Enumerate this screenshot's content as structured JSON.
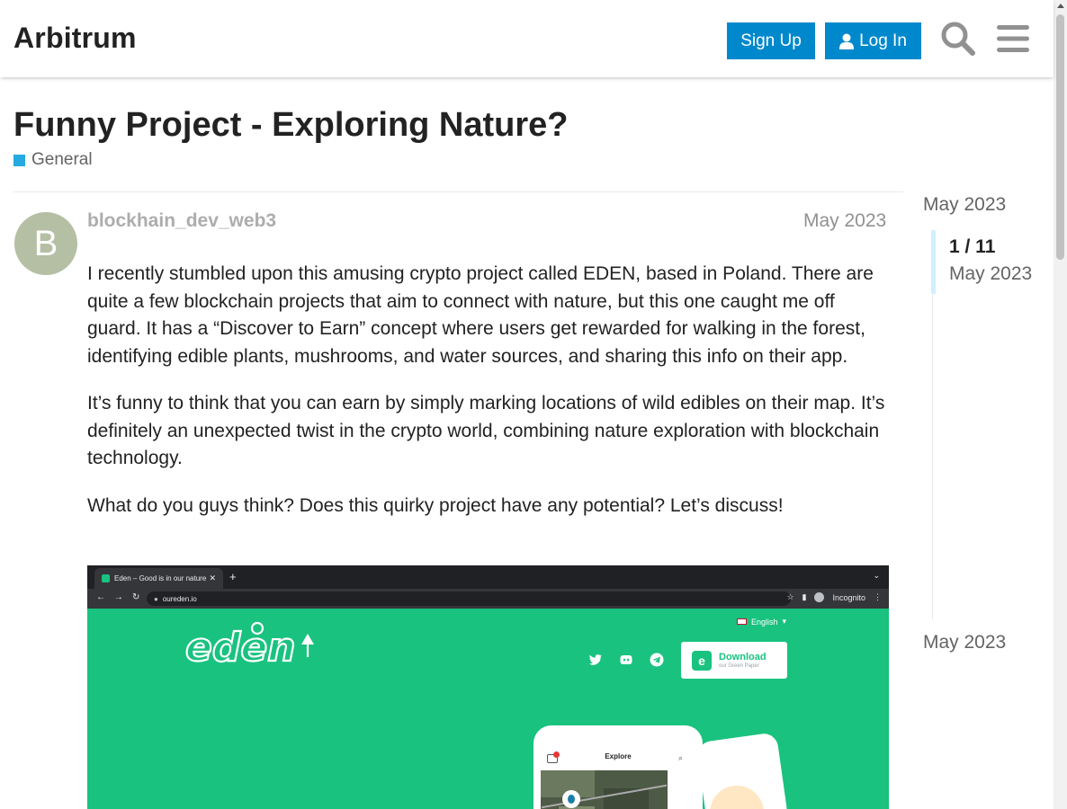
{
  "header": {
    "site_title": "Arbitrum",
    "signup_label": "Sign Up",
    "login_label": "Log In",
    "accent_color": "#0088cc"
  },
  "topic": {
    "title": "Funny Project - Exploring Nature?",
    "category": "General",
    "category_color": "#25aae2"
  },
  "post": {
    "avatar_letter": "B",
    "avatar_color": "#b4bfa4",
    "username": "blockhain_dev_web3",
    "date": "May 2023",
    "paragraphs": [
      "I recently stumbled upon this amusing crypto project called EDEN, based in Poland. There are quite a few blockchain projects that aim to connect with nature, but this one caught me off guard. It has a “Discover to Earn” concept where users get rewarded for walking in the forest, identifying edible plants, mushrooms, and water sources, and sharing this info on their app.",
      "It’s funny to think that you can earn by simply marking locations of wild edibles on their map. It’s definitely an unexpected twist in the crypto world, combining nature exploration with blockchain technology.",
      "What do you guys think? Does this quirky project have any potential? Let’s discuss!"
    ]
  },
  "embed": {
    "tab_title": "Eden – Good is in our nature",
    "url": "oureden.io",
    "incognito_label": "Incognito",
    "logo_text": "eden",
    "language": "English",
    "download_title": "Download",
    "download_subtitle": "our Green Paper",
    "phone_title": "Explore",
    "bg_color": "#19c27f"
  },
  "timeline": {
    "top_date": "May 2023",
    "position": "1 / 11",
    "handle_date": "May 2023",
    "bottom_date": "May 2023"
  },
  "icons": [
    "search-icon",
    "menu-icon",
    "user-icon"
  ]
}
